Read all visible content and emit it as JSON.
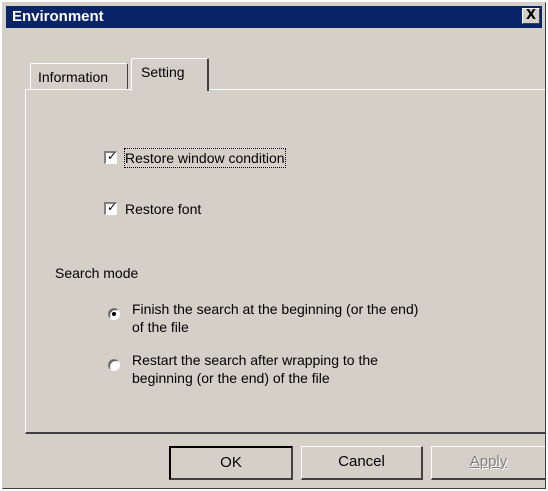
{
  "window": {
    "title": "Environment",
    "close_glyph": "X"
  },
  "tabs": [
    {
      "label": "Information",
      "selected": false
    },
    {
      "label": "Setting",
      "selected": true
    }
  ],
  "settings": {
    "restore_window": {
      "label": "Restore window condition",
      "checked": true
    },
    "restore_font": {
      "label": "Restore font",
      "checked": true
    },
    "search_mode": {
      "label": "Search mode",
      "options": [
        {
          "line1": "Finish the search at the beginning (or the end)",
          "line2": "of the file",
          "selected": true
        },
        {
          "line1": "Restart the search after wrapping to the",
          "line2": "beginning (or the end) of the file",
          "selected": false
        }
      ]
    }
  },
  "buttons": {
    "ok": "OK",
    "cancel": "Cancel",
    "apply": "Apply"
  },
  "colors": {
    "titlebar": "#0a246a",
    "face": "#d4d0c8"
  }
}
